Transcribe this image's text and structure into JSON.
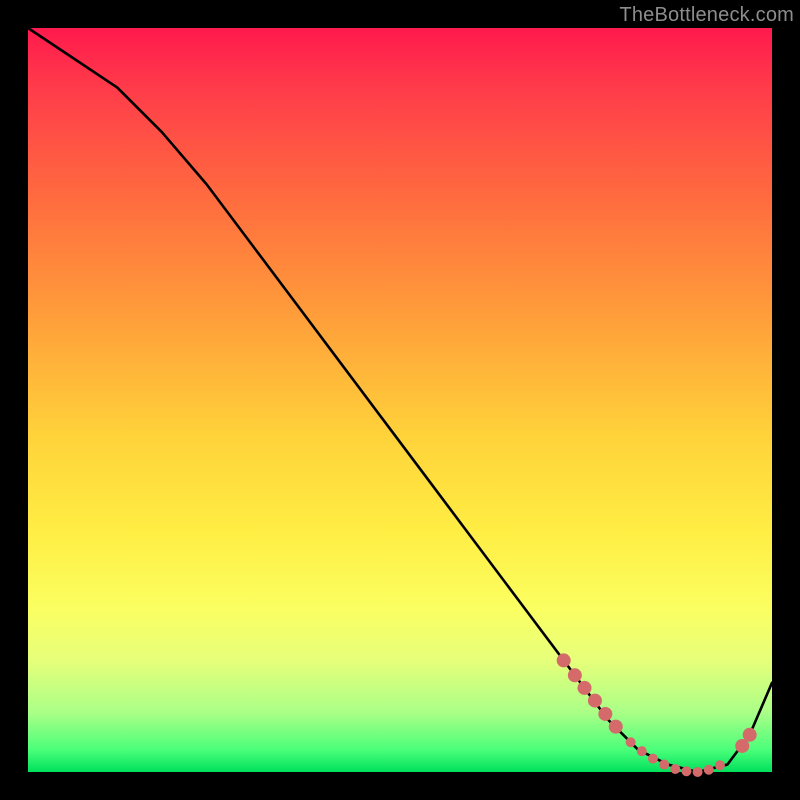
{
  "attribution": "TheBottleneck.com",
  "chart_data": {
    "type": "line",
    "title": "",
    "xlabel": "",
    "ylabel": "",
    "xlim": [
      0,
      100
    ],
    "ylim": [
      0,
      100
    ],
    "grid": false,
    "legend": false,
    "series": [
      {
        "name": "curve",
        "color": "#000000",
        "x": [
          0,
          6,
          12,
          18,
          24,
          30,
          36,
          42,
          48,
          54,
          60,
          66,
          72,
          78,
          82,
          86,
          90,
          94,
          97,
          100
        ],
        "y": [
          100,
          96,
          92,
          86,
          79,
          71,
          63,
          55,
          47,
          39,
          31,
          23,
          15,
          7,
          3,
          1,
          0,
          1,
          5,
          12
        ]
      }
    ],
    "highlight_points": {
      "color": "#d46a6a",
      "radius_small": 5,
      "radius_large": 7,
      "points": [
        {
          "x": 72.0,
          "y": 15.0,
          "r": "large"
        },
        {
          "x": 73.5,
          "y": 13.0,
          "r": "large"
        },
        {
          "x": 74.8,
          "y": 11.3,
          "r": "large"
        },
        {
          "x": 76.2,
          "y": 9.6,
          "r": "large"
        },
        {
          "x": 77.6,
          "y": 7.8,
          "r": "large"
        },
        {
          "x": 79.0,
          "y": 6.1,
          "r": "large"
        },
        {
          "x": 81.0,
          "y": 4.0,
          "r": "small"
        },
        {
          "x": 82.5,
          "y": 2.8,
          "r": "small"
        },
        {
          "x": 84.0,
          "y": 1.8,
          "r": "small"
        },
        {
          "x": 85.5,
          "y": 1.0,
          "r": "small"
        },
        {
          "x": 87.0,
          "y": 0.4,
          "r": "small"
        },
        {
          "x": 88.5,
          "y": 0.1,
          "r": "small"
        },
        {
          "x": 90.0,
          "y": 0.0,
          "r": "small"
        },
        {
          "x": 91.5,
          "y": 0.3,
          "r": "small"
        },
        {
          "x": 93.0,
          "y": 0.9,
          "r": "small"
        },
        {
          "x": 96.0,
          "y": 3.5,
          "r": "large"
        },
        {
          "x": 97.0,
          "y": 5.0,
          "r": "large"
        }
      ]
    }
  },
  "layout": {
    "image_size": 800,
    "margin": 28,
    "plot_size": 744
  }
}
